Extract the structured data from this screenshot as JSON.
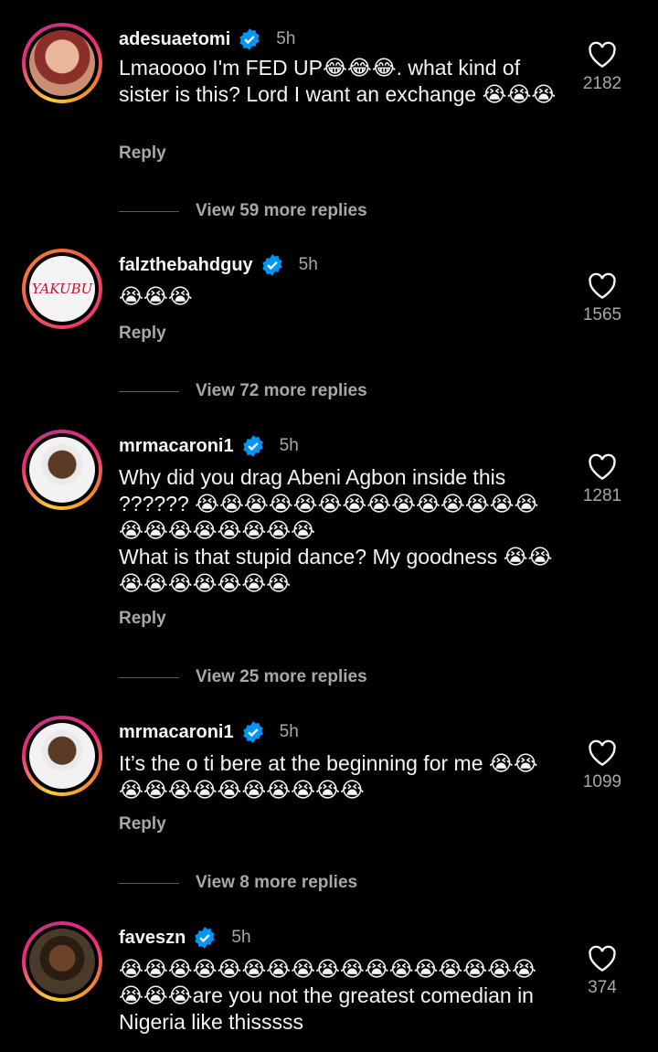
{
  "comments": [
    {
      "username": "adesuaetomi",
      "time": "5h",
      "text": "Lmaoooo I'm FED UP😂😂😂. what kind of sister is this? Lord I want an exchange 😭😭😭",
      "reply_label": "Reply",
      "likes": "2182",
      "view_more": "View 59 more replies"
    },
    {
      "username": "falzthebahdguy",
      "time": "5h",
      "text": "😭😭😭",
      "reply_label": "Reply",
      "likes": "1565",
      "view_more": "View 72 more replies",
      "avatar_text": "YAKUBU"
    },
    {
      "username": "mrmacaroni1",
      "time": "5h",
      "text": "Why did you drag Abeni Agbon inside this ?????? 😭😭😭😭😭😭😭😭😭😭😭😭😭😭😭😭😭😭😭😭😭😭\nWhat is that stupid dance? My goodness 😭😭😭😭😭😭😭😭😭",
      "reply_label": "Reply",
      "likes": "1281",
      "view_more": "View 25 more replies"
    },
    {
      "username": "mrmacaroni1",
      "time": "5h",
      "text": "It’s the o ti bere at the beginning for me 😭😭😭😭😭😭😭😭😭😭😭😭",
      "reply_label": "Reply",
      "likes": "1099",
      "view_more": "View 8 more replies"
    },
    {
      "username": "faveszn",
      "time": "5h",
      "text": "😭😭😭😭😭😭😭😭😭😭😭😭😭😭😭😭😭😭😭😭are you not the greatest comedian in Nigeria like thisssss",
      "reply_label": "Reply",
      "likes": "374"
    }
  ],
  "colors": {
    "background": "#000000",
    "text": "#f5f5f5",
    "secondary_text": "#a8a8a8",
    "verified_badge": "#0095f6",
    "story_ring": [
      "#f9ce34",
      "#ee2a7b",
      "#c13584"
    ]
  },
  "icons": {
    "verified": "verified-badge-icon",
    "like": "heart-outline-icon"
  }
}
